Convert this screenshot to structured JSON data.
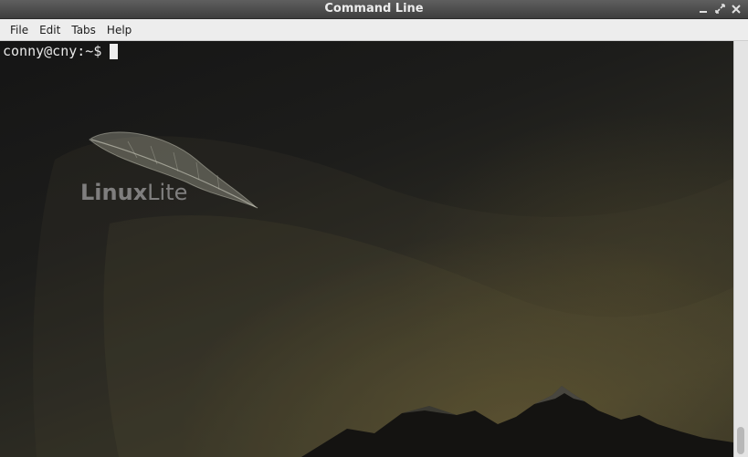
{
  "window": {
    "title": "Command Line"
  },
  "menu": [
    "File",
    "Edit",
    "Tabs",
    "Help"
  ],
  "terminal": {
    "prompt": "conny@cny:~$"
  },
  "wallpaper": {
    "logo_text_bold": "Linux",
    "logo_text_light": "Lite"
  },
  "scrollbar": {
    "position": 1.0
  },
  "colors": {
    "terminal_text": "#e8e8e8",
    "titlebar": "#4a4a4a",
    "menubar": "#ededed"
  },
  "icons": [
    "minimize-icon",
    "maximize-icon",
    "close-icon"
  ]
}
